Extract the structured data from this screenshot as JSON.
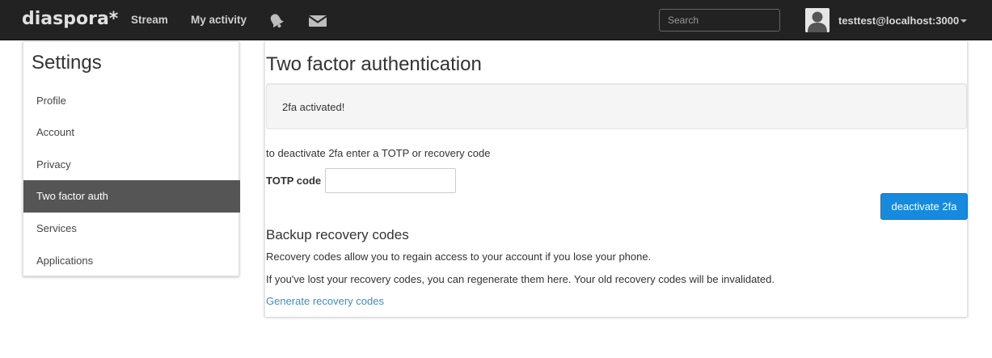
{
  "navbar": {
    "brand": "diaspora*",
    "links": {
      "stream": "Stream",
      "my_activity": "My activity"
    },
    "icons": {
      "notifications": "bell-icon",
      "messages": "envelope-icon"
    },
    "search": {
      "placeholder": "Search",
      "value": ""
    },
    "user": {
      "name": "testtest@localhost:3000"
    }
  },
  "sidebar": {
    "title": "Settings",
    "items": [
      {
        "label": "Profile",
        "active": false
      },
      {
        "label": "Account",
        "active": false
      },
      {
        "label": "Privacy",
        "active": false
      },
      {
        "label": "Two factor auth",
        "active": true
      },
      {
        "label": "Services",
        "active": false
      },
      {
        "label": "Applications",
        "active": false
      }
    ]
  },
  "main": {
    "title": "Two factor authentication",
    "alert": "2fa activated!",
    "instructions": "to deactivate 2fa enter a TOTP or recovery code",
    "totp": {
      "label": "TOTP code",
      "value": ""
    },
    "deactivate_button": "deactivate 2fa",
    "backup": {
      "heading": "Backup recovery codes",
      "paragraph_1": "Recovery codes allow you to regain access to your account if you lose your phone.",
      "paragraph_2": "If you've lost your recovery codes, you can regenerate them here. Your old recovery codes will be invalidated.",
      "link": "Generate recovery codes"
    }
  },
  "colors": {
    "navbar_bg": "#222222",
    "active_item_bg": "#555555",
    "primary_button": "#168ade",
    "link": "#3f8fba"
  }
}
